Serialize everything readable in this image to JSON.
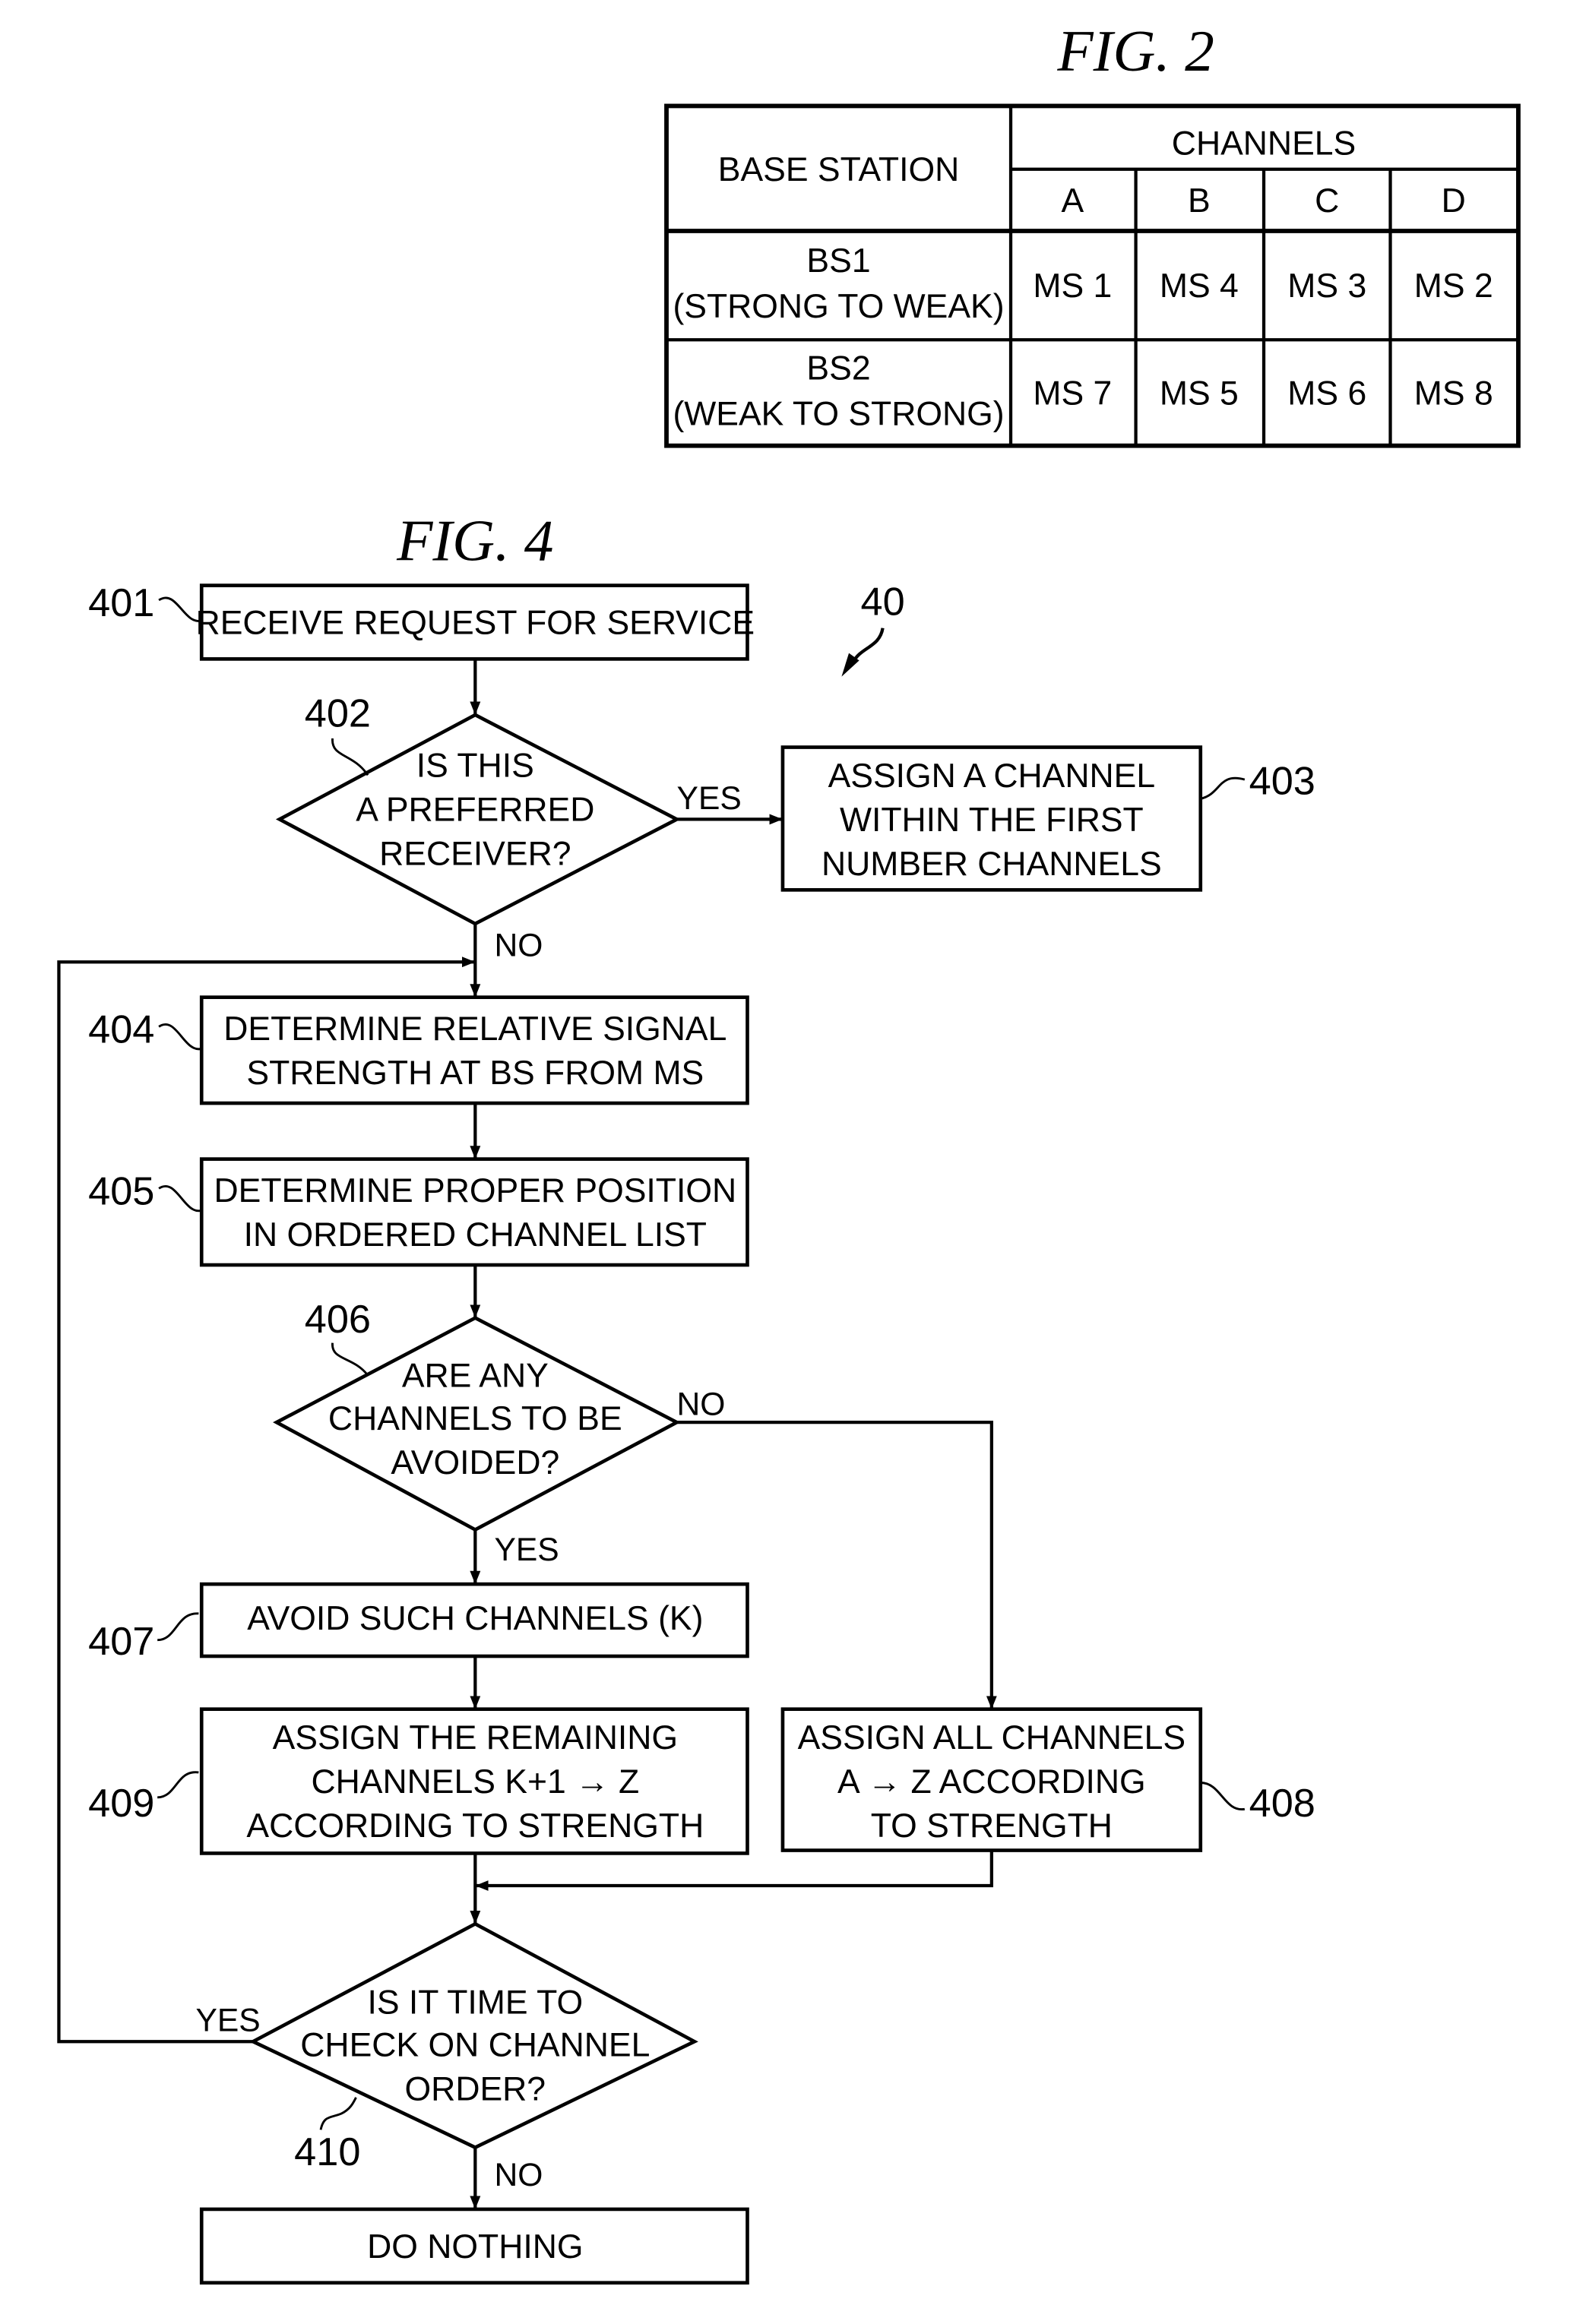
{
  "fig2": {
    "title": "FIG. 2",
    "table": {
      "corner_header": "BASE STATION",
      "group_header": "CHANNELS",
      "columns": [
        "A",
        "B",
        "C",
        "D"
      ],
      "rows": [
        {
          "station": "BS1",
          "order": "(STRONG TO WEAK)",
          "cells": [
            "MS 1",
            "MS 4",
            "MS 3",
            "MS 2"
          ]
        },
        {
          "station": "BS2",
          "order": "(WEAK TO STRONG)",
          "cells": [
            "MS 7",
            "MS 5",
            "MS 6",
            "MS 8"
          ]
        }
      ]
    }
  },
  "fig4": {
    "title": "FIG. 4",
    "ref": "40",
    "steps": {
      "s401": {
        "ref": "401",
        "lines": [
          "RECEIVE REQUEST FOR SERVICE"
        ]
      },
      "s402": {
        "ref": "402",
        "lines": [
          "IS THIS",
          "A PREFERRED",
          "RECEIVER?"
        ]
      },
      "s403": {
        "ref": "403",
        "lines": [
          "ASSIGN A CHANNEL",
          "WITHIN THE FIRST",
          "NUMBER CHANNELS"
        ]
      },
      "s404": {
        "ref": "404",
        "lines": [
          "DETERMINE RELATIVE SIGNAL",
          "STRENGTH AT BS FROM MS"
        ]
      },
      "s405": {
        "ref": "405",
        "lines": [
          "DETERMINE PROPER POSITION",
          "IN ORDERED CHANNEL LIST"
        ]
      },
      "s406": {
        "ref": "406",
        "lines": [
          "ARE ANY",
          "CHANNELS TO BE",
          "AVOIDED?"
        ]
      },
      "s407": {
        "ref": "407",
        "lines": [
          "AVOID SUCH CHANNELS (K)"
        ]
      },
      "s408": {
        "ref": "408",
        "lines": [
          "ASSIGN ALL CHANNELS",
          "A → Z ACCORDING",
          "TO STRENGTH"
        ]
      },
      "s409": {
        "ref": "409",
        "lines": [
          "ASSIGN THE REMAINING",
          "CHANNELS K+1 → Z",
          "ACCORDING TO STRENGTH"
        ]
      },
      "s410": {
        "ref": "410",
        "lines": [
          "IS IT TIME TO",
          "CHECK ON CHANNEL",
          "ORDER?"
        ]
      },
      "s411": {
        "lines": [
          "DO NOTHING"
        ]
      }
    },
    "branch_labels": {
      "d402_yes": "YES",
      "d402_no": "NO",
      "d406_no": "NO",
      "d406_yes": "YES",
      "d410_yes": "YES",
      "d410_no": "NO"
    }
  }
}
